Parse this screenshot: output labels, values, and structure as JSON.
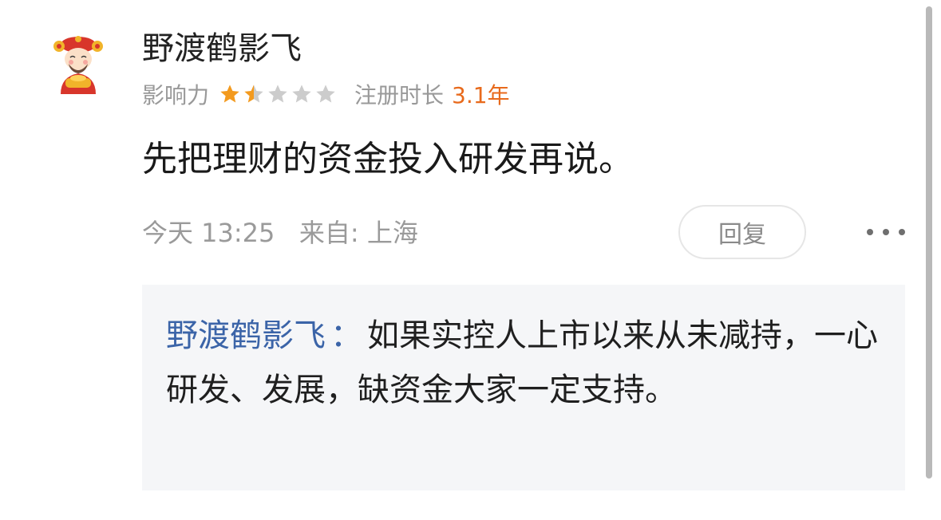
{
  "user": {
    "name": "野渡鹤影飞",
    "avatar_icon": "caishen-avatar-icon",
    "influence_label": "影响力",
    "influence_rating": 1.5,
    "influence_max": 5,
    "tenure_label": "注册时长",
    "tenure_value": "3.1年"
  },
  "comment": {
    "text": "先把理财的资金投入研发再说。",
    "timestamp": "今天 13:25",
    "location": "来自: 上海"
  },
  "actions": {
    "reply_label": "回复",
    "more_icon": "more-dots-icon"
  },
  "quote": {
    "author": "野渡鹤影飞",
    "separator": "：",
    "text": "如果实控人上市以来从未减持，一心研发、发展，缺资金大家一定支持。"
  },
  "colors": {
    "accent_orange": "#e86a1c",
    "star_filled": "#f39a1e",
    "star_empty": "#cccccc",
    "quote_author": "#3b64a8",
    "quote_bg": "#f5f6f8"
  }
}
